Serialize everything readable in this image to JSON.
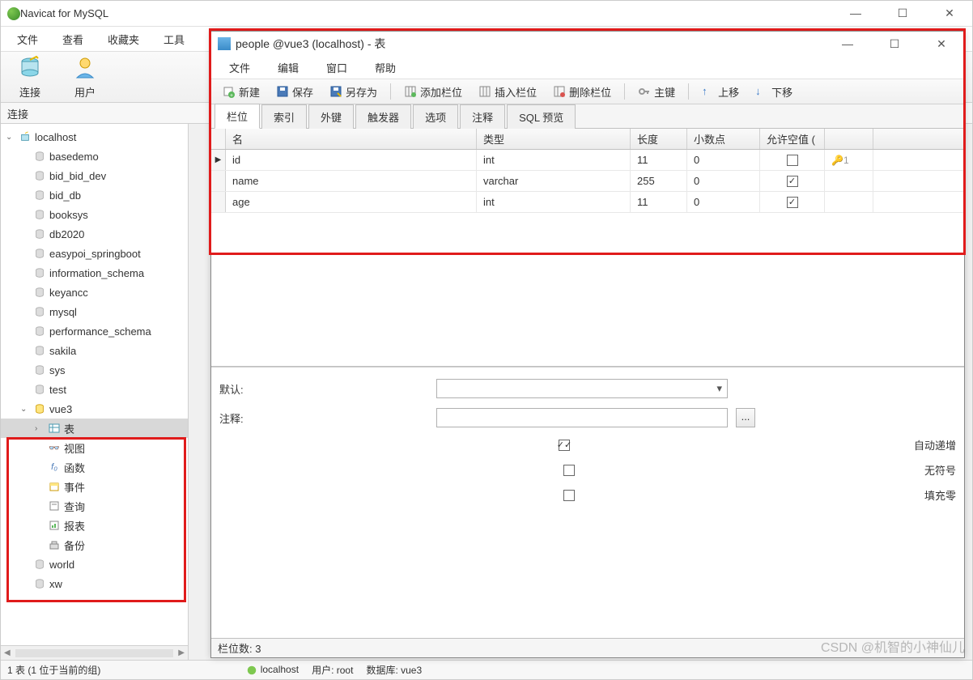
{
  "app": {
    "title": "Navicat for MySQL"
  },
  "main_window_controls": {
    "min": "—",
    "max": "☐",
    "close": "✕"
  },
  "main_menu": [
    "文件",
    "查看",
    "收藏夹",
    "工具"
  ],
  "main_toolbar": {
    "connect": "连接",
    "user": "用户"
  },
  "sidebar_header": "连接",
  "tree": {
    "root": "localhost",
    "databases": [
      "basedemo",
      "bid_bid_dev",
      "bid_db",
      "booksys",
      "db2020",
      "easypoi_springboot",
      "information_schema",
      "keyancc",
      "mysql",
      "performance_schema",
      "sakila",
      "sys",
      "test"
    ],
    "active_db": "vue3",
    "vue3_children": [
      {
        "label": "表",
        "icon": "table-icon",
        "sel": true
      },
      {
        "label": "视图",
        "icon": "view-icon"
      },
      {
        "label": "函数",
        "icon": "function-icon"
      },
      {
        "label": "事件",
        "icon": "event-icon"
      },
      {
        "label": "查询",
        "icon": "query-icon"
      },
      {
        "label": "报表",
        "icon": "report-icon"
      },
      {
        "label": "备份",
        "icon": "backup-icon"
      }
    ],
    "after": [
      "world",
      "xw"
    ]
  },
  "statusbar": {
    "left": "1 表 (1 位于当前的组)",
    "conn": "localhost",
    "user_label": "用户:",
    "user": "root",
    "db_label": "数据库:",
    "db": "vue3"
  },
  "inner": {
    "title": "people @vue3 (localhost) - 表",
    "menu": [
      "文件",
      "编辑",
      "窗口",
      "帮助"
    ],
    "toolbar": {
      "new": "新建",
      "save": "保存",
      "saveas": "另存为",
      "addcol": "添加栏位",
      "insertcol": "插入栏位",
      "delcol": "删除栏位",
      "pk": "主键",
      "up": "上移",
      "down": "下移"
    },
    "tabs": [
      "栏位",
      "索引",
      "外键",
      "触发器",
      "选项",
      "注释",
      "SQL 预览"
    ],
    "active_tab": 0,
    "grid_headers": {
      "name": "名",
      "type": "类型",
      "len": "长度",
      "dec": "小数点",
      "null": "允许空值 ("
    },
    "rows": [
      {
        "name": "id",
        "type": "int",
        "len": "11",
        "dec": "0",
        "null": false,
        "pk": "1",
        "current": true
      },
      {
        "name": "name",
        "type": "varchar",
        "len": "255",
        "dec": "0",
        "null": true
      },
      {
        "name": "age",
        "type": "int",
        "len": "11",
        "dec": "0",
        "null": true
      }
    ],
    "props": {
      "default_label": "默认:",
      "comment_label": "注释:",
      "auto_inc": "自动递增",
      "unsigned": "无符号",
      "zerofill": "填充零",
      "auto_inc_checked": true
    },
    "status": "栏位数: 3"
  },
  "watermark": "CSDN @机智的小神仙儿"
}
